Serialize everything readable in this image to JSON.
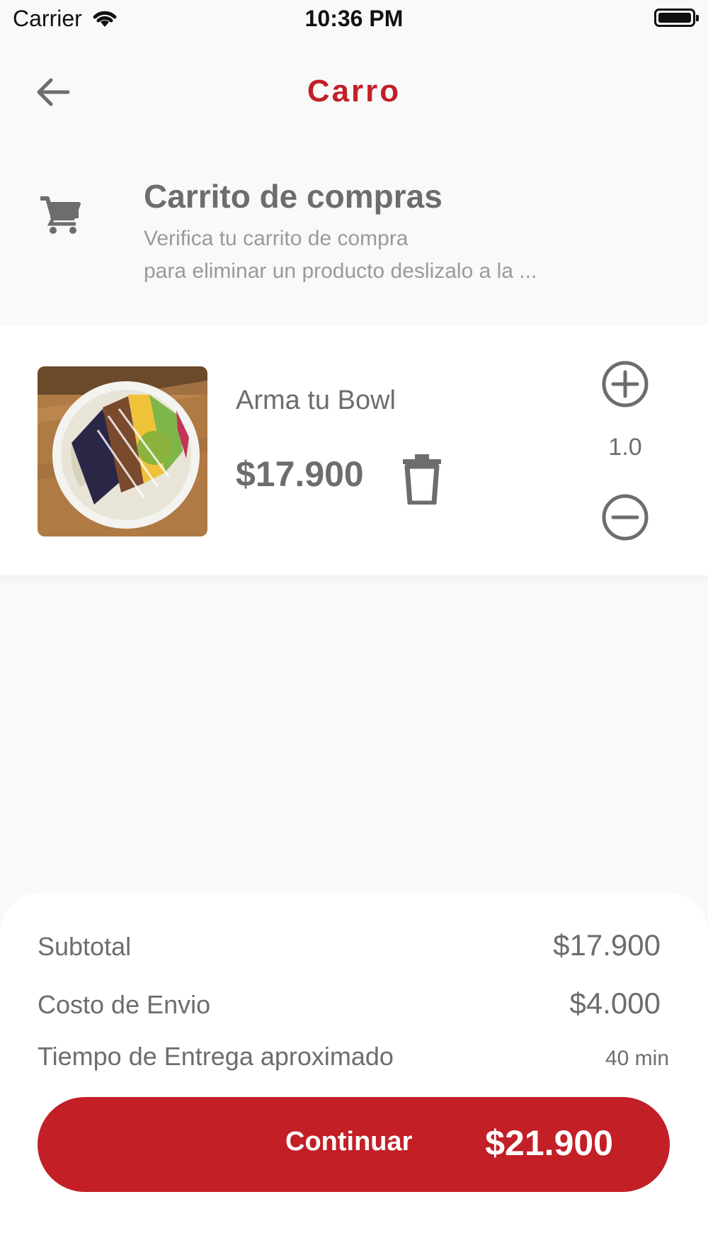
{
  "status_bar": {
    "carrier": "Carrier",
    "time": "10:36 PM"
  },
  "app_bar": {
    "title": "Carro",
    "accent_color": "#c21f27"
  },
  "cart_header": {
    "title": "Carrito de compras",
    "subtitle_line1": "Verifica tu carrito de compra",
    "subtitle_line2": "para eliminar un producto deslizalo a la ..."
  },
  "items": [
    {
      "name": "Arma tu Bowl",
      "price": "$17.900",
      "quantity": "1.0"
    }
  ],
  "summary": {
    "subtotal_label": "Subtotal",
    "subtotal_value": "$17.900",
    "shipping_label": "Costo de Envio",
    "shipping_value": "$4.000",
    "delivery_label": "Tiempo de Entrega aproximado",
    "delivery_value": "40 min"
  },
  "continue_button": {
    "label": "Continuar",
    "total": "$21.900"
  }
}
